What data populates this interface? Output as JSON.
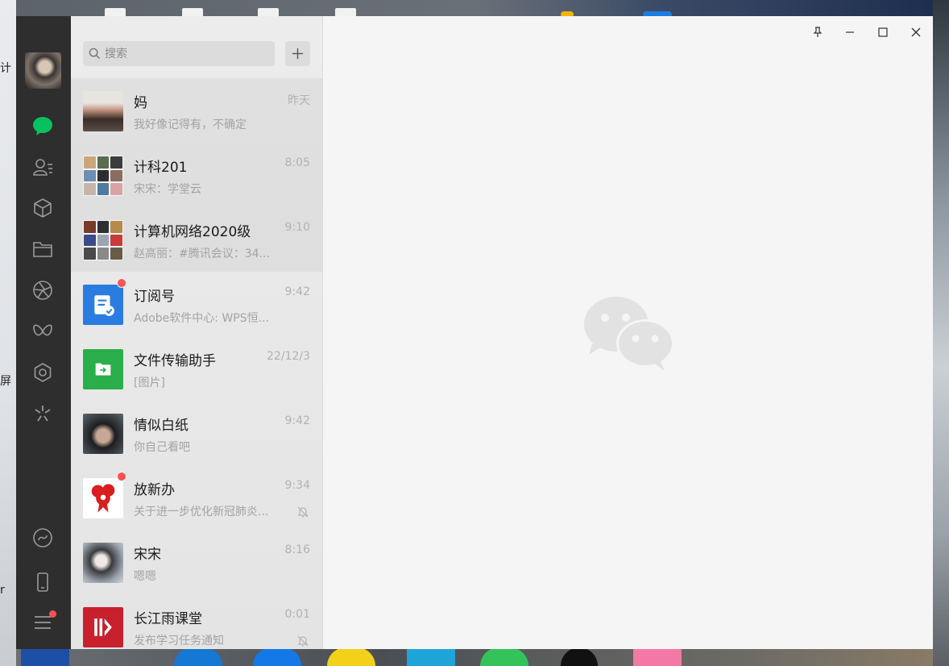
{
  "desktop": {
    "left_chars": [
      "计",
      "屏",
      "r"
    ]
  },
  "search": {
    "placeholder": "搜索"
  },
  "chats": [
    {
      "name": "妈",
      "time": "昨天",
      "preview": "我好像记得有，不确定",
      "pinned": true,
      "unread_dot": false,
      "muted": false,
      "avatar": "photo-mom"
    },
    {
      "name": "计科201",
      "time": "8:05",
      "preview": "宋宋：学堂云",
      "pinned": true,
      "unread_dot": false,
      "muted": false,
      "avatar": "group-grid"
    },
    {
      "name": "计算机网络2020级",
      "time": "9:10",
      "preview": "赵高丽：#腾讯会议：34...",
      "pinned": true,
      "unread_dot": false,
      "muted": false,
      "avatar": "group-grid"
    },
    {
      "name": "订阅号",
      "time": "9:42",
      "preview": "Adobe软件中心: WPS恒...",
      "pinned": false,
      "unread_dot": true,
      "muted": false,
      "avatar": "subscription"
    },
    {
      "name": "文件传输助手",
      "time": "22/12/3",
      "preview": "[图片]",
      "pinned": false,
      "unread_dot": false,
      "muted": false,
      "avatar": "file-transfer"
    },
    {
      "name": "情似白纸",
      "time": "9:42",
      "preview": "你自己看吧",
      "pinned": false,
      "unread_dot": false,
      "muted": false,
      "avatar": "photo-boy"
    },
    {
      "name": "放新办",
      "time": "9:34",
      "preview": "关于进一步优化新冠肺炎...",
      "pinned": false,
      "unread_dot": true,
      "muted": true,
      "avatar": "red-logo"
    },
    {
      "name": "宋宋",
      "time": "8:16",
      "preview": "嗯嗯",
      "pinned": false,
      "unread_dot": false,
      "muted": false,
      "avatar": "photo-girl"
    },
    {
      "name": "长江雨课堂",
      "time": "0:01",
      "preview": "发布学习任务通知",
      "pinned": false,
      "unread_dot": false,
      "muted": true,
      "avatar": "rain-classroom"
    }
  ],
  "sidebar_icons": [
    "chat-icon",
    "contacts-icon",
    "favorites-icon",
    "folder-icon",
    "moments-icon",
    "channels-icon",
    "search-discover-icon",
    "mini-programs-icon",
    "mini-program-link-icon",
    "phone-icon",
    "menu-icon"
  ],
  "colors": {
    "accent_green": "#07c160",
    "badge_red": "#fa5151",
    "sidebar_bg": "#2e2e2e",
    "list_bg": "#e9e9e9",
    "main_bg": "#f5f5f5"
  }
}
